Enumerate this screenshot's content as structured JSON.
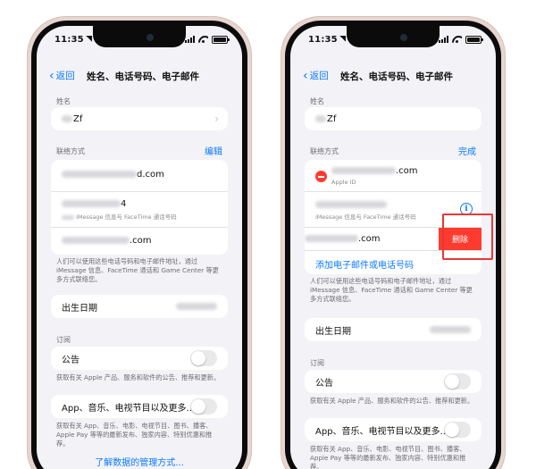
{
  "status": {
    "time": "11:35"
  },
  "nav": {
    "back_label": "返回",
    "title": "姓名、电话号码、电子邮件"
  },
  "name_section": {
    "label": "姓名",
    "value": "Zf"
  },
  "contact_section": {
    "label": "联络方式",
    "edit_label": "编辑",
    "done_label": "完成",
    "left_items": [
      {
        "value": "d.com"
      },
      {
        "value": "4",
        "sub": "iMessage 信息与 FaceTime 通话号码"
      },
      {
        "value": ".com"
      }
    ],
    "right_items": [
      {
        "value": ".com",
        "sub": "Apple ID"
      },
      {
        "sub": "iMessage 信息与 FaceTime 通话号码"
      },
      {
        "value": ".com"
      }
    ],
    "add_label": "添加电子邮件或电话号码",
    "delete_label": "删除",
    "note": "人们可以使用这些电话号码和电子邮件地址，通过 iMessage 信息、FaceTime 通话和 Game Center 等更多方式联络您。"
  },
  "birthday": {
    "label": "出生日期"
  },
  "subscriptions": {
    "label": "订阅",
    "announcements": {
      "label": "公告",
      "note": "获取有关 Apple 产品、服务和软件的公告、推荐和更新。",
      "enabled": false
    },
    "apps": {
      "label": "App、音乐、电视节目以及更多...",
      "note": "获取有关 App、音乐、电影、电视节目、图书、播客、Apple Pay 等等的最新发布、独家内容、特别优惠和推荐。",
      "enabled": false
    }
  },
  "footer": {
    "manage_link": "了解数据的管理方式..."
  },
  "colors": {
    "accent": "#0a7aff",
    "destructive": "#ff3b30",
    "background": "#f2f2f7"
  }
}
